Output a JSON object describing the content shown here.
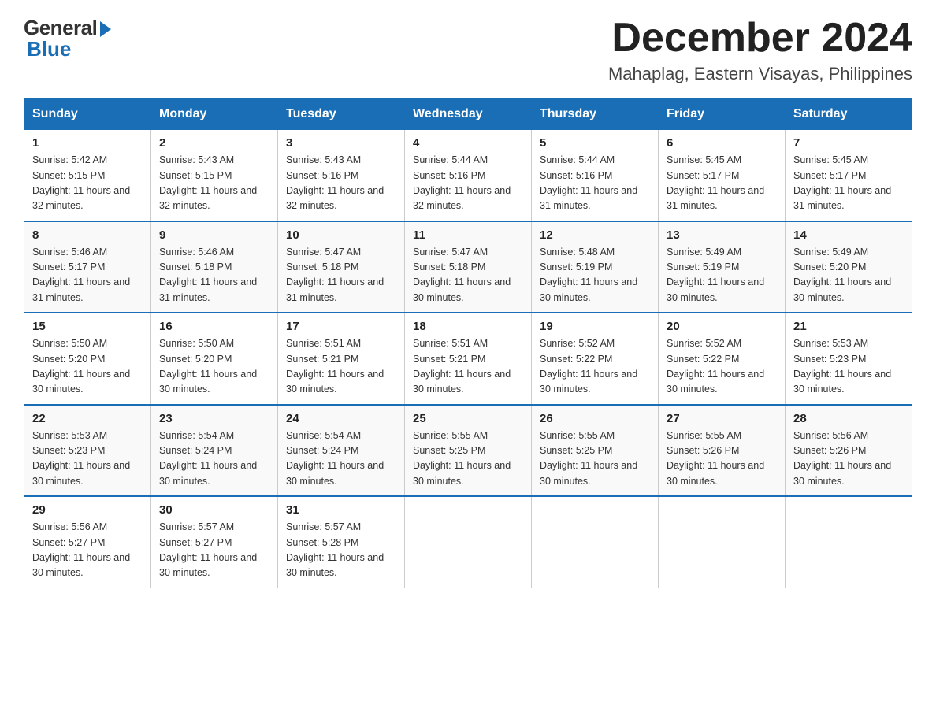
{
  "header": {
    "logo_general": "General",
    "logo_blue": "Blue",
    "month_year": "December 2024",
    "location": "Mahaplag, Eastern Visayas, Philippines"
  },
  "calendar": {
    "days_of_week": [
      "Sunday",
      "Monday",
      "Tuesday",
      "Wednesday",
      "Thursday",
      "Friday",
      "Saturday"
    ],
    "weeks": [
      [
        {
          "date": "1",
          "sunrise": "5:42 AM",
          "sunset": "5:15 PM",
          "daylight": "11 hours and 32 minutes."
        },
        {
          "date": "2",
          "sunrise": "5:43 AM",
          "sunset": "5:15 PM",
          "daylight": "11 hours and 32 minutes."
        },
        {
          "date": "3",
          "sunrise": "5:43 AM",
          "sunset": "5:16 PM",
          "daylight": "11 hours and 32 minutes."
        },
        {
          "date": "4",
          "sunrise": "5:44 AM",
          "sunset": "5:16 PM",
          "daylight": "11 hours and 32 minutes."
        },
        {
          "date": "5",
          "sunrise": "5:44 AM",
          "sunset": "5:16 PM",
          "daylight": "11 hours and 31 minutes."
        },
        {
          "date": "6",
          "sunrise": "5:45 AM",
          "sunset": "5:17 PM",
          "daylight": "11 hours and 31 minutes."
        },
        {
          "date": "7",
          "sunrise": "5:45 AM",
          "sunset": "5:17 PM",
          "daylight": "11 hours and 31 minutes."
        }
      ],
      [
        {
          "date": "8",
          "sunrise": "5:46 AM",
          "sunset": "5:17 PM",
          "daylight": "11 hours and 31 minutes."
        },
        {
          "date": "9",
          "sunrise": "5:46 AM",
          "sunset": "5:18 PM",
          "daylight": "11 hours and 31 minutes."
        },
        {
          "date": "10",
          "sunrise": "5:47 AM",
          "sunset": "5:18 PM",
          "daylight": "11 hours and 31 minutes."
        },
        {
          "date": "11",
          "sunrise": "5:47 AM",
          "sunset": "5:18 PM",
          "daylight": "11 hours and 30 minutes."
        },
        {
          "date": "12",
          "sunrise": "5:48 AM",
          "sunset": "5:19 PM",
          "daylight": "11 hours and 30 minutes."
        },
        {
          "date": "13",
          "sunrise": "5:49 AM",
          "sunset": "5:19 PM",
          "daylight": "11 hours and 30 minutes."
        },
        {
          "date": "14",
          "sunrise": "5:49 AM",
          "sunset": "5:20 PM",
          "daylight": "11 hours and 30 minutes."
        }
      ],
      [
        {
          "date": "15",
          "sunrise": "5:50 AM",
          "sunset": "5:20 PM",
          "daylight": "11 hours and 30 minutes."
        },
        {
          "date": "16",
          "sunrise": "5:50 AM",
          "sunset": "5:20 PM",
          "daylight": "11 hours and 30 minutes."
        },
        {
          "date": "17",
          "sunrise": "5:51 AM",
          "sunset": "5:21 PM",
          "daylight": "11 hours and 30 minutes."
        },
        {
          "date": "18",
          "sunrise": "5:51 AM",
          "sunset": "5:21 PM",
          "daylight": "11 hours and 30 minutes."
        },
        {
          "date": "19",
          "sunrise": "5:52 AM",
          "sunset": "5:22 PM",
          "daylight": "11 hours and 30 minutes."
        },
        {
          "date": "20",
          "sunrise": "5:52 AM",
          "sunset": "5:22 PM",
          "daylight": "11 hours and 30 minutes."
        },
        {
          "date": "21",
          "sunrise": "5:53 AM",
          "sunset": "5:23 PM",
          "daylight": "11 hours and 30 minutes."
        }
      ],
      [
        {
          "date": "22",
          "sunrise": "5:53 AM",
          "sunset": "5:23 PM",
          "daylight": "11 hours and 30 minutes."
        },
        {
          "date": "23",
          "sunrise": "5:54 AM",
          "sunset": "5:24 PM",
          "daylight": "11 hours and 30 minutes."
        },
        {
          "date": "24",
          "sunrise": "5:54 AM",
          "sunset": "5:24 PM",
          "daylight": "11 hours and 30 minutes."
        },
        {
          "date": "25",
          "sunrise": "5:55 AM",
          "sunset": "5:25 PM",
          "daylight": "11 hours and 30 minutes."
        },
        {
          "date": "26",
          "sunrise": "5:55 AM",
          "sunset": "5:25 PM",
          "daylight": "11 hours and 30 minutes."
        },
        {
          "date": "27",
          "sunrise": "5:55 AM",
          "sunset": "5:26 PM",
          "daylight": "11 hours and 30 minutes."
        },
        {
          "date": "28",
          "sunrise": "5:56 AM",
          "sunset": "5:26 PM",
          "daylight": "11 hours and 30 minutes."
        }
      ],
      [
        {
          "date": "29",
          "sunrise": "5:56 AM",
          "sunset": "5:27 PM",
          "daylight": "11 hours and 30 minutes."
        },
        {
          "date": "30",
          "sunrise": "5:57 AM",
          "sunset": "5:27 PM",
          "daylight": "11 hours and 30 minutes."
        },
        {
          "date": "31",
          "sunrise": "5:57 AM",
          "sunset": "5:28 PM",
          "daylight": "11 hours and 30 minutes."
        },
        null,
        null,
        null,
        null
      ]
    ]
  }
}
